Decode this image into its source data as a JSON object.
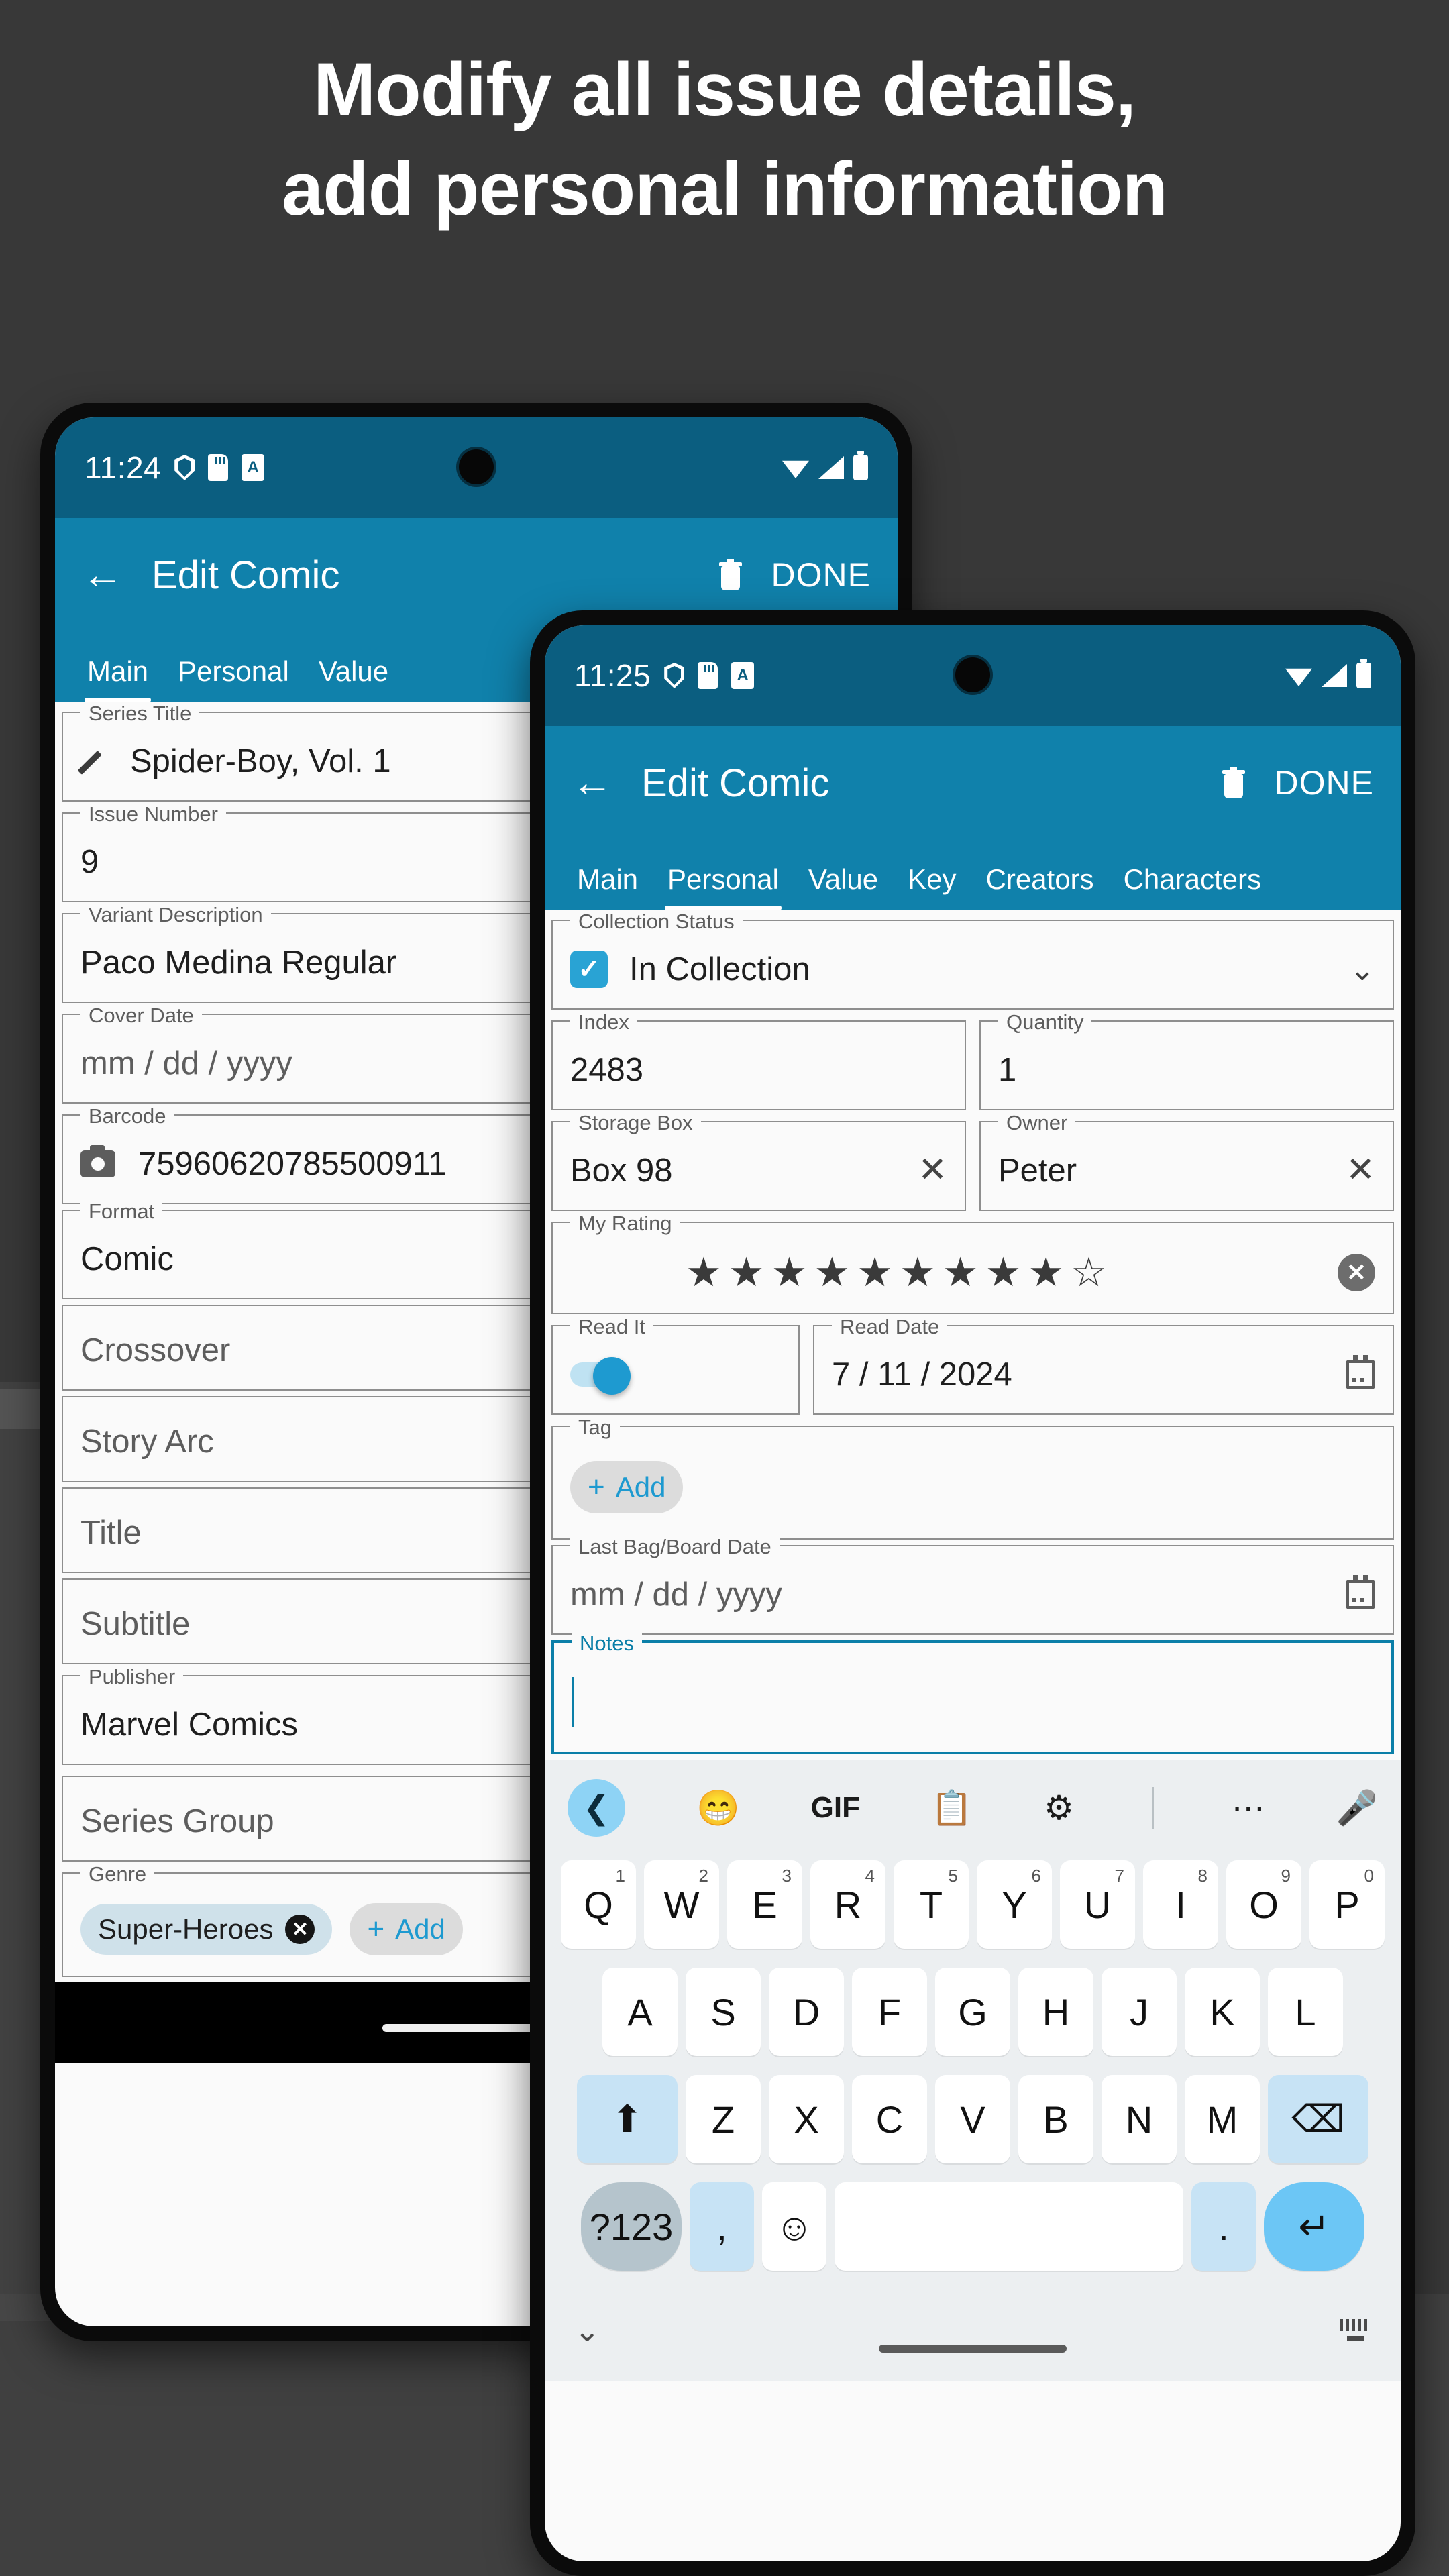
{
  "headline": {
    "line1": "Modify all issue details,",
    "line2": "add personal information"
  },
  "colors": {
    "background": "#383838",
    "status_bar": "#0b5e80",
    "app_bar": "#1081ab",
    "accent": "#1e9ad0",
    "focus_border": "#0b7fa8",
    "chip": "#cfe1ea"
  },
  "phone1": {
    "status": {
      "time": "11:24",
      "icons": [
        "shield-icon",
        "sd-card-icon",
        "a-badge-icon",
        "wifi-icon",
        "signal-icon",
        "battery-icon"
      ]
    },
    "appbar": {
      "back": "←",
      "title": "Edit Comic",
      "delete": "trash-icon",
      "done": "DONE"
    },
    "tabs": [
      {
        "label": "Main",
        "active": true
      },
      {
        "label": "Personal",
        "active": false
      },
      {
        "label": "Value",
        "active": false
      }
    ],
    "fields": [
      {
        "label": "Series Title",
        "value": "Spider-Boy, Vol. 1",
        "icon": "pencil-icon"
      },
      {
        "label": "Issue Number",
        "value": "9"
      },
      {
        "label": "Variant Description",
        "value": "Paco Medina Regular"
      },
      {
        "label": "Cover Date",
        "placeholder": "mm / dd / yyyy",
        "trail": "calendar-icon"
      },
      {
        "label": "Barcode",
        "value": "75960620785500911",
        "icon": "camera-icon"
      },
      {
        "label": "Format",
        "value": "Comic"
      },
      {
        "label": "",
        "placeholder": "Crossover"
      },
      {
        "label": "",
        "placeholder": "Story Arc"
      },
      {
        "label": "",
        "placeholder": "Title"
      },
      {
        "label": "",
        "placeholder": "Subtitle"
      },
      {
        "label": "Publisher",
        "value": "Marvel Comics",
        "trail": "clear-icon"
      },
      {
        "label": "",
        "placeholder": "Series Group",
        "trail": "chevron-down-icon"
      },
      {
        "label": "Genre",
        "chips": [
          "Super-Heroes"
        ],
        "add_label": "Add"
      }
    ]
  },
  "phone2": {
    "status": {
      "time": "11:25",
      "icons": [
        "shield-icon",
        "sd-card-icon",
        "a-badge-icon",
        "wifi-icon",
        "signal-icon",
        "battery-icon"
      ]
    },
    "appbar": {
      "back": "←",
      "title": "Edit Comic",
      "delete": "trash-icon",
      "done": "DONE"
    },
    "tabs": [
      {
        "label": "Main",
        "active": false
      },
      {
        "label": "Personal",
        "active": true
      },
      {
        "label": "Value",
        "active": false
      },
      {
        "label": "Key",
        "active": false
      },
      {
        "label": "Creators",
        "active": false
      },
      {
        "label": "Characters",
        "active": false
      }
    ],
    "collection_status": {
      "label": "Collection Status",
      "value": "In Collection",
      "checked": true
    },
    "index": {
      "label": "Index",
      "value": "2483"
    },
    "quantity": {
      "label": "Quantity",
      "value": "1"
    },
    "storage_box": {
      "label": "Storage Box",
      "value": "Box 98"
    },
    "owner": {
      "label": "Owner",
      "value": "Peter"
    },
    "rating": {
      "label": "My Rating",
      "filled": 9,
      "total": 10
    },
    "read_it": {
      "label": "Read It",
      "on": true
    },
    "read_date": {
      "label": "Read Date",
      "value": "7 / 11 / 2024"
    },
    "tag": {
      "label": "Tag",
      "add_label": "Add"
    },
    "bag_board": {
      "label": "Last Bag/Board Date",
      "placeholder": "mm / dd / yyyy"
    },
    "notes": {
      "label": "Notes",
      "value": ""
    },
    "keyboard": {
      "toolbar": [
        "chevron-left-icon",
        "sticker-icon",
        "GIF",
        "clipboard-icon",
        "gear-icon",
        "more-icon",
        "mic-icon"
      ],
      "row1": [
        {
          "k": "Q",
          "n": "1"
        },
        {
          "k": "W",
          "n": "2"
        },
        {
          "k": "E",
          "n": "3"
        },
        {
          "k": "R",
          "n": "4"
        },
        {
          "k": "T",
          "n": "5"
        },
        {
          "k": "Y",
          "n": "6"
        },
        {
          "k": "U",
          "n": "7"
        },
        {
          "k": "I",
          "n": "8"
        },
        {
          "k": "O",
          "n": "9"
        },
        {
          "k": "P",
          "n": "0"
        }
      ],
      "row2": [
        "A",
        "S",
        "D",
        "F",
        "G",
        "H",
        "J",
        "K",
        "L"
      ],
      "row3": [
        "⬆",
        "Z",
        "X",
        "C",
        "V",
        "B",
        "N",
        "M",
        "⌫"
      ],
      "row4": [
        "?123",
        ",",
        "☺",
        "",
        ".",
        "↵"
      ]
    }
  }
}
